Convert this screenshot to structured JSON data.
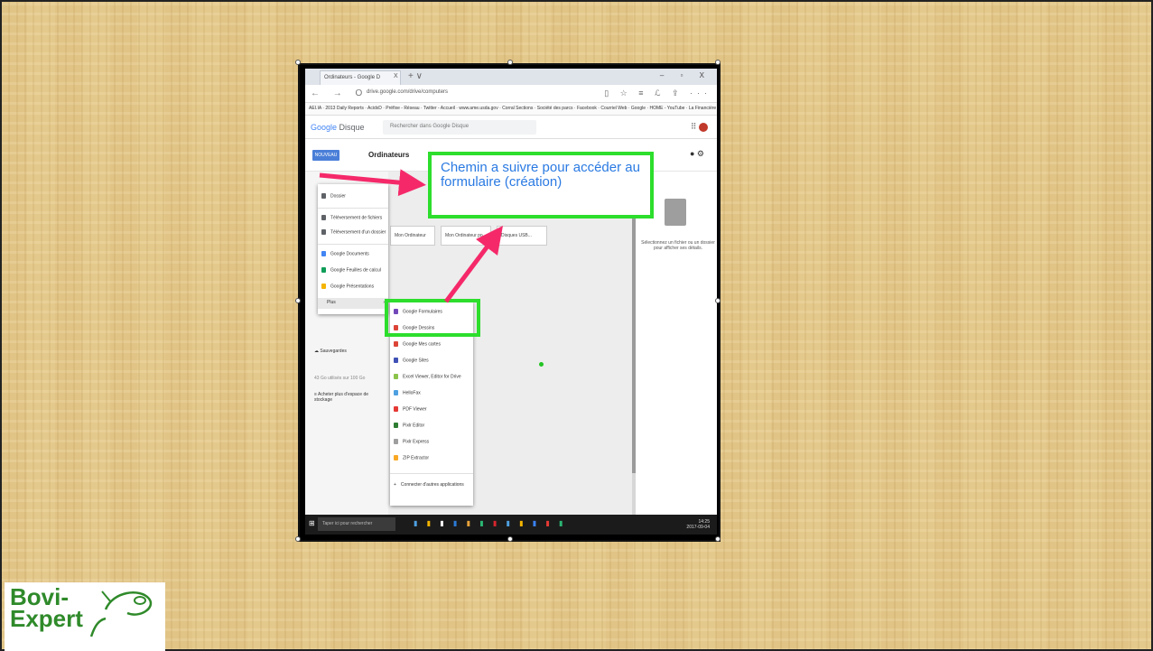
{
  "callout": {
    "text": "Chemin a suivre pour accéder au formulaire (création)"
  },
  "browser": {
    "tab_title": "Ordinateurs - Google D",
    "tab_close": "X",
    "tab_new": "+ ∨",
    "window_controls": "– ▫ X",
    "nav_icons": "← → O",
    "url": "drive.google.com/drive/computers",
    "addr_right_icons": "▯ ☆ ≡ ℒ ⇪ ···",
    "favorites": "AEI.IA · 2013 Daily Reports · AcidxD · Préfixe - Réseau · Twitter - Accueil · www.ame.usda.gov · Corral Sections · Société des parcs · Facebook · Courriel Web · Google · HOME - YouTube · La Financière"
  },
  "drive": {
    "logo_google": "Google",
    "logo_disque": "Disque",
    "search_placeholder": "Rechercher dans Google Disque",
    "new_button": "NOUVEAU",
    "section_title": "Ordinateurs",
    "cards": [
      "Mon Ordinateur",
      "Mon Ordinateur po...",
      "Disques USB..."
    ],
    "details_text": "Sélectionnez un fichier ou un dossier pour afficher ses détails.",
    "nav": {
      "backups": "Sauvegardes",
      "quota": "43 Go utilisés sur 100 Go",
      "buy_storage": "Acheter plus d'espace de stockage"
    }
  },
  "menu1": {
    "items": [
      {
        "label": "Dossier",
        "color": "#5f6368"
      },
      {
        "label": "Téléversement de fichiers",
        "color": "#5f6368"
      },
      {
        "label": "Téléversement d'un dossier",
        "color": "#5f6368"
      },
      {
        "label": "Google Documents",
        "color": "#4285f4"
      },
      {
        "label": "Google Feuilles de calcul",
        "color": "#0f9d58"
      },
      {
        "label": "Google Présentations",
        "color": "#f4b400"
      },
      {
        "label": "Plus",
        "color": "transparent"
      }
    ],
    "more_chevron": "›"
  },
  "menu2": {
    "items": [
      {
        "label": "Google Formulaires",
        "color": "#7248b9"
      },
      {
        "label": "Google Dessins",
        "color": "#db4437"
      },
      {
        "label": "Google Mes cartes",
        "color": "#db4437"
      },
      {
        "label": "Google Sites",
        "color": "#3f51b5"
      },
      {
        "label": "Excel Viewer, Editor for Drive",
        "color": "#8bc34a"
      },
      {
        "label": "HelloFax",
        "color": "#4ea0e0"
      },
      {
        "label": "PDF Viewer",
        "color": "#e53935"
      },
      {
        "label": "Pixlr Editor",
        "color": "#2e7d32"
      },
      {
        "label": "Pixlr Express",
        "color": "#9e9e9e"
      },
      {
        "label": "ZIP Extractor",
        "color": "#f9a825"
      }
    ],
    "connect_plus": "+",
    "connect_label": "Connecter d'autres applications"
  },
  "taskbar": {
    "search_placeholder": "Taper ici pour rechercher",
    "apps": "▮ ▮ ▮ ▮ ▮ ▮ ▮ ▮ ▮ ▮ ▮ ▮ ▮ ▮",
    "time": "14:25",
    "date": "2017-09-04"
  },
  "logo": {
    "line1": "Bovi-",
    "line2": "Expert"
  },
  "colors": {
    "highlight": "#2dde2d",
    "arrow": "#f5296a",
    "callout_text": "#2a7ae2"
  }
}
